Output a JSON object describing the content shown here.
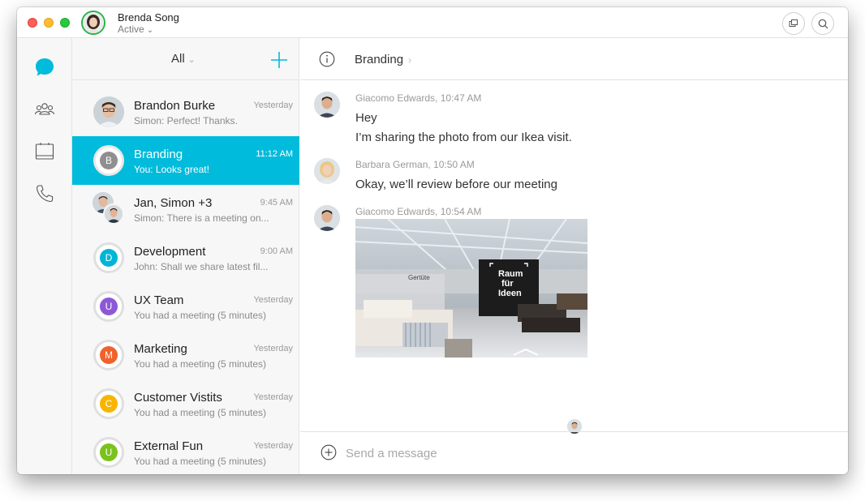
{
  "user": {
    "name": "Brenda Song",
    "status": "Active"
  },
  "list": {
    "filter": "All",
    "conversations": [
      {
        "name": "Brandon Burke",
        "preview": "Simon: Perfect! Thanks.",
        "time": "Yesterday",
        "avatar": "photo"
      },
      {
        "name": "Branding",
        "preview": "You: Looks great!",
        "time": "11:12 AM",
        "initial": "B",
        "color": "#8f8f8f"
      },
      {
        "name": "Jan, Simon +3",
        "preview": "Simon: There is a meeting on...",
        "time": "9:45 AM",
        "avatar": "group-photo"
      },
      {
        "name": "Development",
        "preview": "John: Shall we share latest fil...",
        "time": "9:00 AM",
        "initial": "D",
        "color": "#00b5d6"
      },
      {
        "name": "UX Team",
        "preview": "You had a meeting (5 minutes)",
        "time": "Yesterday",
        "initial": "U",
        "color": "#8c59d6"
      },
      {
        "name": "Marketing",
        "preview": "You had a meeting (5 minutes)",
        "time": "Yesterday",
        "initial": "M",
        "color": "#f0622b"
      },
      {
        "name": "Customer Vistits",
        "preview": "You had a meeting (5 minutes)",
        "time": "Yesterday",
        "initial": "C",
        "color": "#f8b500"
      },
      {
        "name": "External Fun",
        "preview": "You had a meeting (5 minutes)",
        "time": "Yesterday",
        "initial": "U",
        "color": "#7bc21d"
      }
    ]
  },
  "chat": {
    "title": "Branding",
    "messages": [
      {
        "sender": "Giacomo Edwards",
        "time": "10:47 AM",
        "lines": [
          "Hey",
          "I’m sharing the photo from our Ikea visit."
        ]
      },
      {
        "sender": "Barbara German",
        "time": "10:50 AM",
        "lines": [
          "Okay, we’ll review before our meeting"
        ]
      },
      {
        "sender": "Giacomo Edwards",
        "time": "10:54 AM",
        "image_sign": [
          "Raum",
          "für",
          "Ideen"
        ],
        "image_label": "Gertüte"
      }
    ],
    "composer_placeholder": "Send a message"
  },
  "colors": {
    "accent": "#00bbdb",
    "presence": "#26b64b"
  }
}
